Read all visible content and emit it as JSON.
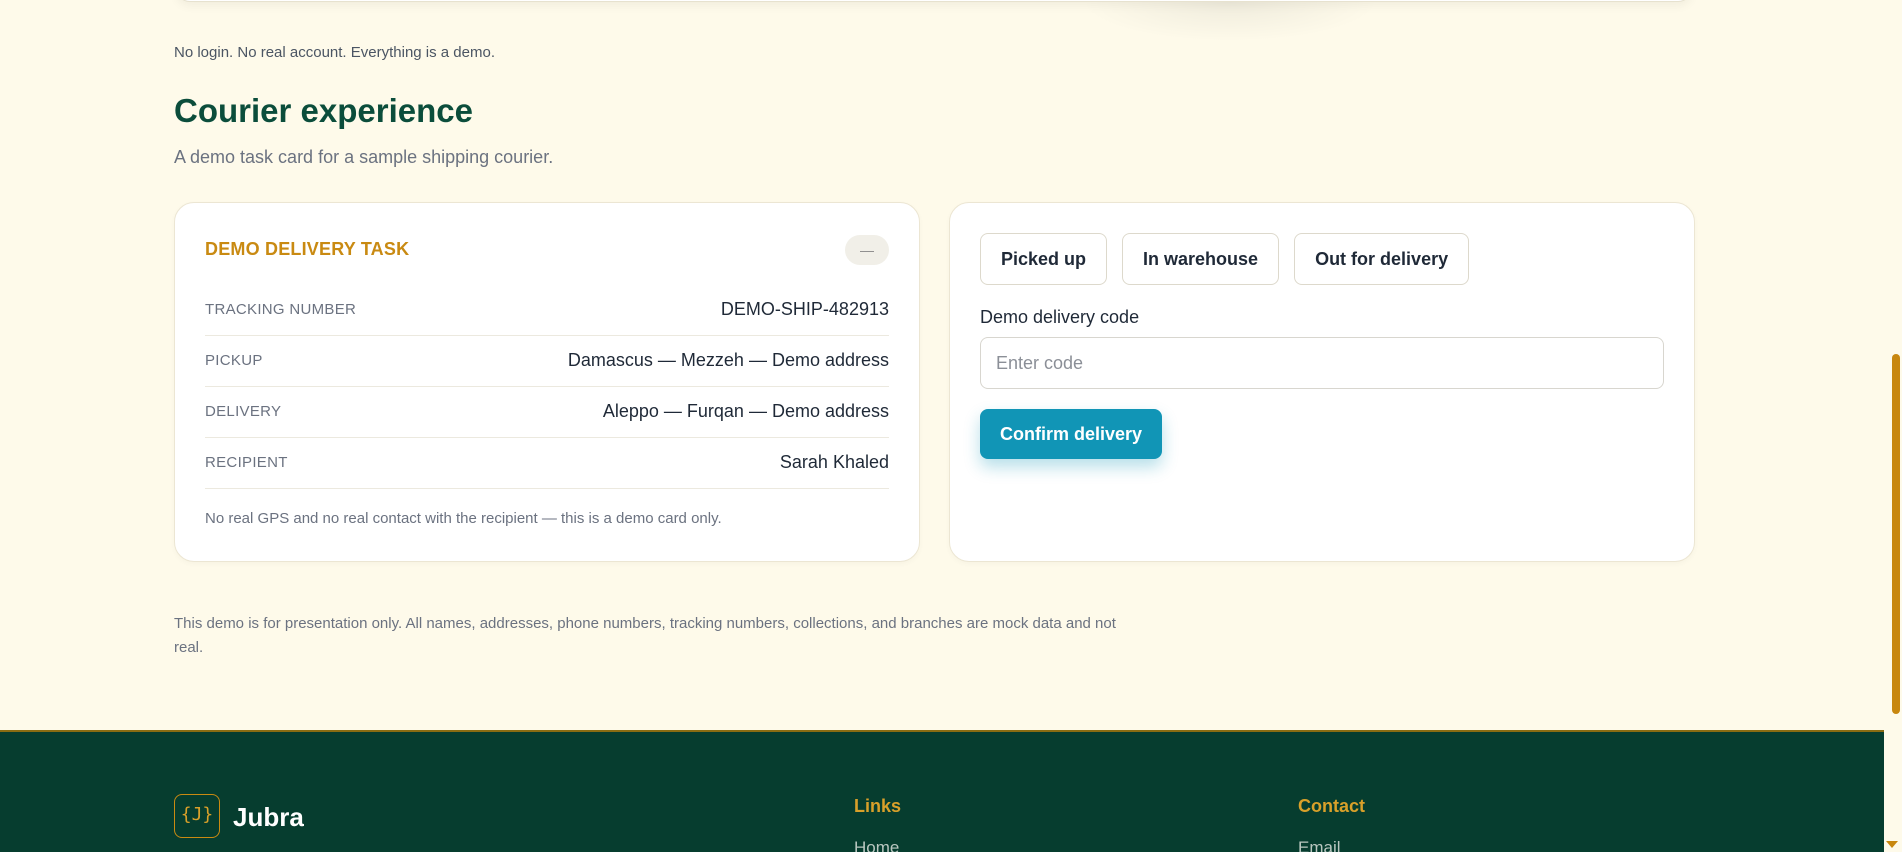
{
  "intro": {
    "demo_note": "No login. No real account. Everything is a demo."
  },
  "courier": {
    "title": "Courier experience",
    "subtitle": "A demo task card for a sample shipping courier."
  },
  "task_card": {
    "title": "DEMO DELIVERY TASK",
    "badge": "—",
    "rows": [
      {
        "label": "TRACKING NUMBER",
        "value": "DEMO-SHIP-482913"
      },
      {
        "label": "PICKUP",
        "value": "Damascus — Mezzeh — Demo address"
      },
      {
        "label": "DELIVERY",
        "value": "Aleppo — Furqan — Demo address"
      },
      {
        "label": "RECIPIENT",
        "value": "Sarah Khaled"
      }
    ],
    "note": "No real GPS and no real contact with the recipient — this is a demo card only."
  },
  "actions": {
    "status_buttons": [
      "Picked up",
      "In warehouse",
      "Out for delivery"
    ],
    "code_label": "Demo delivery code",
    "code_placeholder": "Enter code",
    "code_value": "",
    "confirm_label": "Confirm delivery"
  },
  "disclaimer": "This demo is for presentation only. All names, addresses, phone numbers, tracking numbers, collections, and branches are mock data and not real.",
  "footer": {
    "logo_glyph": "{J}",
    "brand": "Jubra",
    "links_heading": "Links",
    "links": [
      "Home"
    ],
    "contact_heading": "Contact",
    "contact": [
      "Email"
    ]
  },
  "colors": {
    "background": "#fefaea",
    "heading_green": "#0b4d3b",
    "accent_gold": "#c98a12",
    "primary_teal": "#1195b6",
    "footer_green": "#063d2f"
  }
}
